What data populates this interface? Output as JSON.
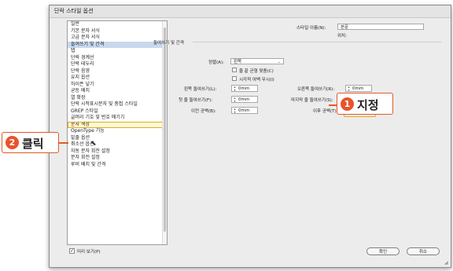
{
  "dialog": {
    "title": "단락 스타일 옵션",
    "sidebar_items": [
      "일반",
      "기본 문자 서식",
      "고급 문자 서식",
      "들여쓰기 및 간격",
      "탭",
      "단락 경계선",
      "단락 테두리",
      "단락 음영",
      "유지 옵션",
      "하이픈 넣기",
      "균등 배치",
      "열 확장",
      "단락 시작표시문자 및 중첩 스타일",
      "GREP 스타일",
      "글머리 기호 및 번호 매기기",
      "문자 색상",
      "OpenType 기능",
      "밑줄 옵션",
      "취소선 옵션",
      "자동 문자 회전 설정",
      "문자 회전 설정",
      "루비 배치 및 간격"
    ],
    "selected_item": "들여쓰기 및 간격",
    "highlighted_item": "문자 색상"
  },
  "main": {
    "style_name_label": "스타일 이름(N):",
    "style_name_value": "본문",
    "location_label": "위치:",
    "section_title": "들여쓰기 및 간격",
    "alignment_label": "정렬(A):",
    "alignment_value": "왼쪽",
    "balance_lines_label": "줄 끝 균형 맞춤(C)",
    "ignore_optical_label": "시각적 여백 무시(I)",
    "left_indent_label": "왼쪽 들여쓰기(L):",
    "left_indent_value": "0mm",
    "right_indent_label": "오른쪽 들여쓰기(R):",
    "right_indent_value": "0mm",
    "first_line_indent_label": "첫 줄 들여쓰기(F):",
    "first_line_indent_value": "0mm",
    "last_line_indent_label": "마지막 줄 들여쓰기(S):",
    "last_line_indent_value": "0mm",
    "space_before_label": "이전 공백(B):",
    "space_before_value": "0mm",
    "space_after_label": "이후 공백(T):",
    "space_after_value": "3mm"
  },
  "footer": {
    "preview_label": "미리 보기(P)",
    "ok_label": "확인",
    "cancel_label": "취소"
  },
  "annotations": {
    "step1_number": "1",
    "step1_text": "지정",
    "step2_number": "2",
    "step2_text": "클릭",
    "accent_color": "#e8542a"
  }
}
